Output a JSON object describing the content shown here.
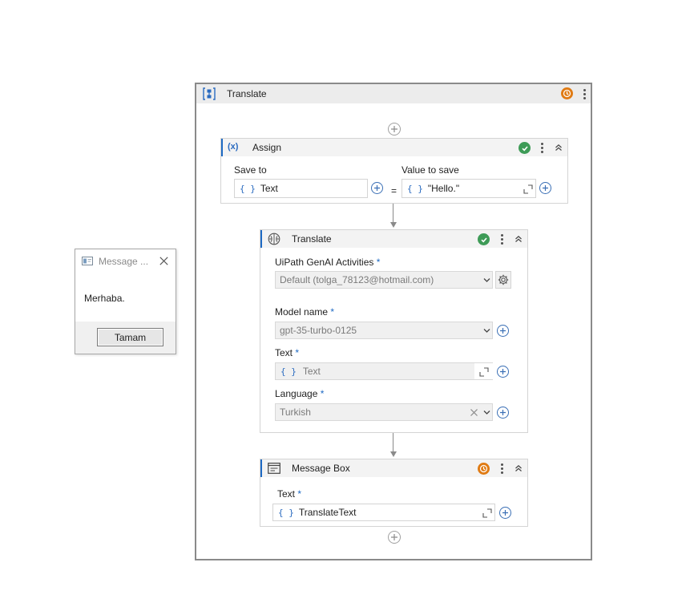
{
  "sequence": {
    "title": "Translate",
    "status": "warning"
  },
  "assign": {
    "title": "Assign",
    "icon_label": "(x)",
    "status": "valid",
    "save_to_label": "Save to",
    "save_to_value": "Text",
    "equals": "=",
    "value_label": "Value to save",
    "value_value": "\"Hello.\""
  },
  "translate": {
    "title": "Translate",
    "status": "valid",
    "connection_label": "UiPath GenAI Activities",
    "connection_value": "Default (tolga_78123@hotmail.com)",
    "model_label": "Model name",
    "model_value": "gpt-35-turbo-0125",
    "text_label": "Text",
    "text_value": "Text",
    "language_label": "Language",
    "language_value": "Turkish",
    "required_mark": "*"
  },
  "message_box": {
    "title": "Message Box",
    "status": "warning",
    "text_label": "Text",
    "text_value": "TranslateText",
    "required_mark": "*"
  },
  "brace_glyph": "{ }",
  "popup": {
    "title": "Message ...",
    "body": "Merhaba.",
    "button": "Tamam"
  },
  "colors": {
    "accent": "#1e6ac4",
    "valid": "#3e9b57",
    "warning": "#e07b14",
    "border": "#8a8a8a"
  }
}
